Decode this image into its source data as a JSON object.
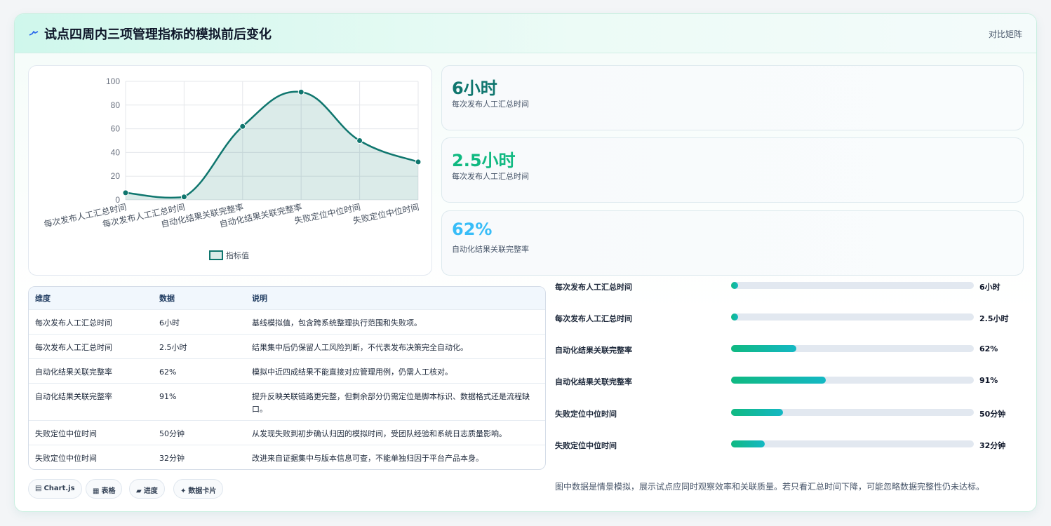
{
  "header": {
    "icon": "pulse-icon",
    "title": "试点四周内三项管理指标的模拟前后变化",
    "link_label": "对比矩阵"
  },
  "stats": [
    {
      "value": "6小时",
      "label": "每次发布人工汇总时间",
      "color": "#0f766e"
    },
    {
      "value": "2.5小时",
      "label": "每次发布人工汇总时间",
      "color": "#10b981"
    },
    {
      "value": "62%",
      "label": "自动化结果关联完整率",
      "color": "#38bdf8"
    }
  ],
  "table": {
    "headers": [
      "维度",
      "数据",
      "说明"
    ],
    "rows": [
      {
        "dim": "每次发布人工汇总时间",
        "data": "6小时",
        "desc": "基线模拟值，包含跨系统整理执行范围和失败项。"
      },
      {
        "dim": "每次发布人工汇总时间",
        "data": "2.5小时",
        "desc": "结果集中后仍保留人工风险判断，不代表发布决策完全自动化。"
      },
      {
        "dim": "自动化结果关联完整率",
        "data": "62%",
        "desc": "模拟中近四成结果不能直接对应管理用例，仍需人工核对。"
      },
      {
        "dim": "自动化结果关联完整率",
        "data": "91%",
        "desc": "提升反映关联链路更完整，但剩余部分仍需定位是脚本标识、数据格式还是流程缺口。"
      },
      {
        "dim": "失败定位中位时间",
        "data": "50分钟",
        "desc": "从发现失败到初步确认归因的模拟时间，受团队经验和系统日志质量影响。"
      },
      {
        "dim": "失败定位中位时间",
        "data": "32分钟",
        "desc": "改进来自证据集中与版本信息可查，不能单独归因于平台产品本身。"
      }
    ]
  },
  "progress": [
    {
      "label": "每次发布人工汇总时间",
      "value": "6小时",
      "fraction": 0.02
    },
    {
      "label": "每次发布人工汇总时间",
      "value": "2.5小时",
      "fraction": 0.02
    },
    {
      "label": "自动化结果关联完整率",
      "value": "62%",
      "fraction": 0.27
    },
    {
      "label": "自动化结果关联完整率",
      "value": "91%",
      "fraction": 0.39
    },
    {
      "label": "失败定位中位时间",
      "value": "50分钟",
      "fraction": 0.215
    },
    {
      "label": "失败定位中位时间",
      "value": "32分钟",
      "fraction": 0.138
    }
  ],
  "note": "图中数据是情景模拟，展示试点应同时观察效率和关联质量。若只看汇总时间下降，可能忽略数据完整性仍未达标。",
  "tags": [
    {
      "icon": "chart-icon",
      "glyph": "▤",
      "label": "Chart.js"
    },
    {
      "icon": "table-icon",
      "glyph": "▦",
      "label": "表格"
    },
    {
      "icon": "progress-icon",
      "glyph": "▰",
      "label": "进度"
    },
    {
      "icon": "sparkle-icon",
      "glyph": "✦",
      "label": "数据卡片"
    }
  ],
  "chart_data": {
    "type": "line",
    "categories": [
      "每次发布人工汇总时间",
      "每次发布人工汇总时间",
      "自动化结果关联完整率",
      "自动化结果关联完整率",
      "失败定位中位时间",
      "失败定位中位时间"
    ],
    "series": [
      {
        "name": "指标值",
        "values": [
          6,
          2.5,
          62,
          91,
          50,
          32
        ]
      }
    ],
    "ylim": [
      0,
      100
    ],
    "yticks": [
      0,
      20,
      40,
      60,
      80,
      100
    ],
    "grid": true,
    "fill": true,
    "smooth": true,
    "legend_position": "bottom",
    "colors": {
      "line": "#0f766e",
      "fill": "rgba(15,118,110,0.15)"
    }
  }
}
